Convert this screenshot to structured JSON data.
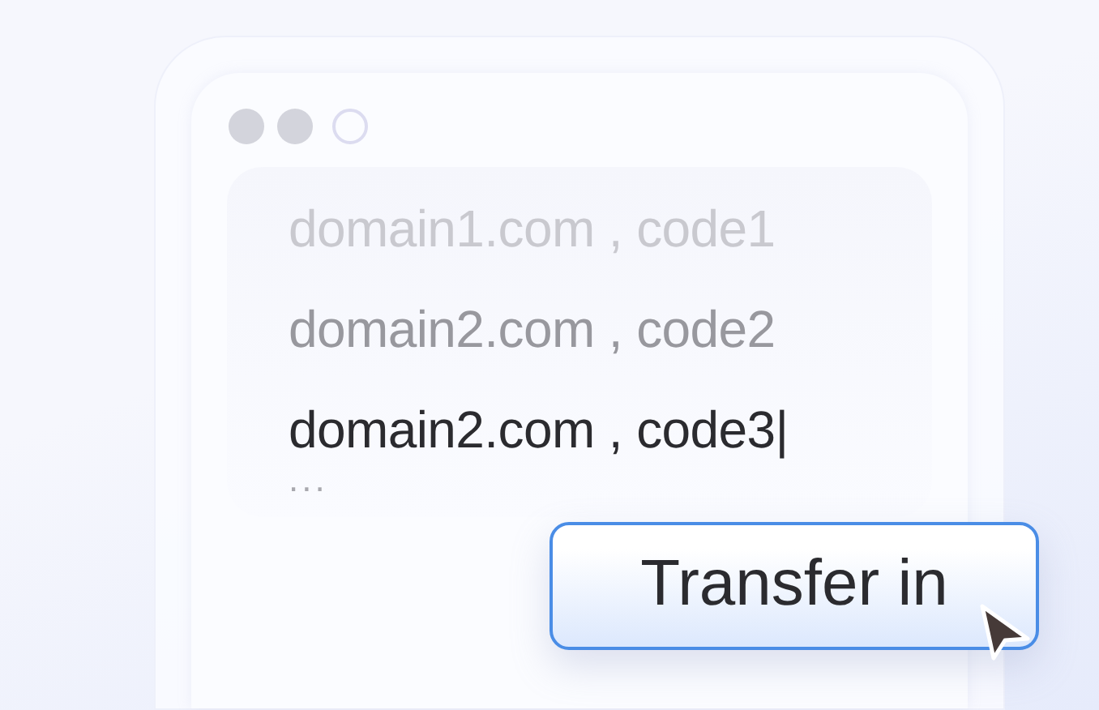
{
  "window": {
    "controls": [
      {
        "filled": true
      },
      {
        "filled": true
      },
      {
        "filled": false
      }
    ]
  },
  "entries": [
    {
      "text": "domain1.com , code1",
      "kind": "faded"
    },
    {
      "text": "domain2.com , code2",
      "kind": "muted"
    },
    {
      "text": "domain2.com , code3|",
      "kind": "active"
    }
  ],
  "more": "...",
  "button": {
    "label": "Transfer in"
  }
}
